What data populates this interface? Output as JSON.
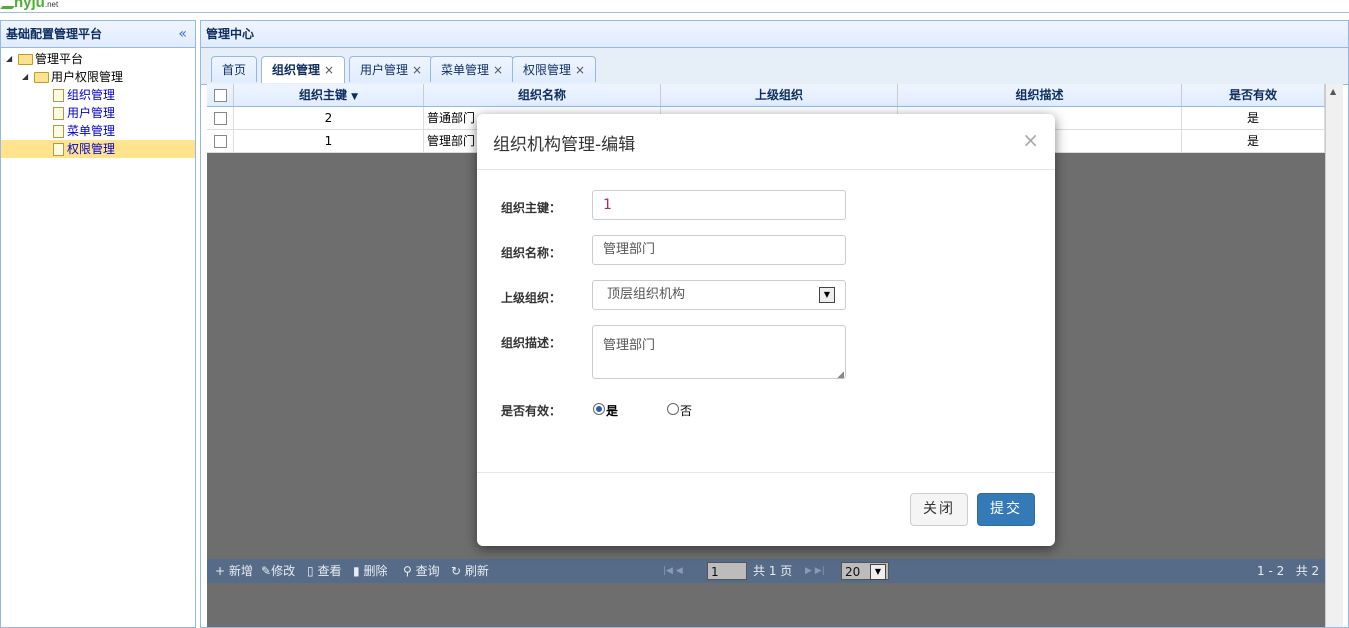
{
  "logo": {
    "text": "nyju",
    "suffix": ".net"
  },
  "west": {
    "title": "基础配置管理平台",
    "tree": [
      {
        "label": "管理平台",
        "level": 0,
        "type": "folder"
      },
      {
        "label": "用户权限管理",
        "level": 1,
        "type": "folder"
      },
      {
        "label": "组织管理",
        "level": 2,
        "type": "file"
      },
      {
        "label": "用户管理",
        "level": 2,
        "type": "file"
      },
      {
        "label": "菜单管理",
        "level": 2,
        "type": "file"
      },
      {
        "label": "权限管理",
        "level": 2,
        "type": "file",
        "selected": true
      }
    ]
  },
  "center": {
    "title": "管理中心",
    "tabs": [
      {
        "label": "首页"
      },
      {
        "label": "组织管理",
        "active": true
      },
      {
        "label": "用户管理"
      },
      {
        "label": "菜单管理"
      },
      {
        "label": "权限管理"
      }
    ]
  },
  "grid": {
    "columns": [
      "组织主键",
      "组织名称",
      "上级组织",
      "组织描述",
      "是否有效"
    ],
    "rows": [
      {
        "id": "2",
        "name": "普通部门",
        "valid": "是"
      },
      {
        "id": "1",
        "name": "管理部门",
        "valid": "是"
      }
    ],
    "toolbar": {
      "add": "新增",
      "edit": "修改",
      "view": "查看",
      "delete": "删除",
      "query": "查询",
      "refresh": "刷新"
    },
    "pager": {
      "page": "1",
      "total_pages_text": "共 1 页",
      "page_size": "20",
      "range_text": "1 - 2",
      "total_text": "共 2"
    }
  },
  "modal": {
    "title": "组织机构管理-编辑",
    "fields": {
      "id_label": "组织主键：",
      "id_value": "1",
      "name_label": "组织名称：",
      "name_value": "管理部门",
      "parent_label": "上级组织：",
      "parent_value": "顶层组织机构",
      "desc_label": "组织描述：",
      "desc_value": "管理部门",
      "valid_label": "是否有效：",
      "valid_yes": "是",
      "valid_no": "否"
    },
    "close_button": "关闭",
    "submit_button": "提交"
  },
  "colors": {
    "accent": "#337ab7",
    "panel_border": "#95b8e7",
    "selected": "#ffe48d"
  }
}
